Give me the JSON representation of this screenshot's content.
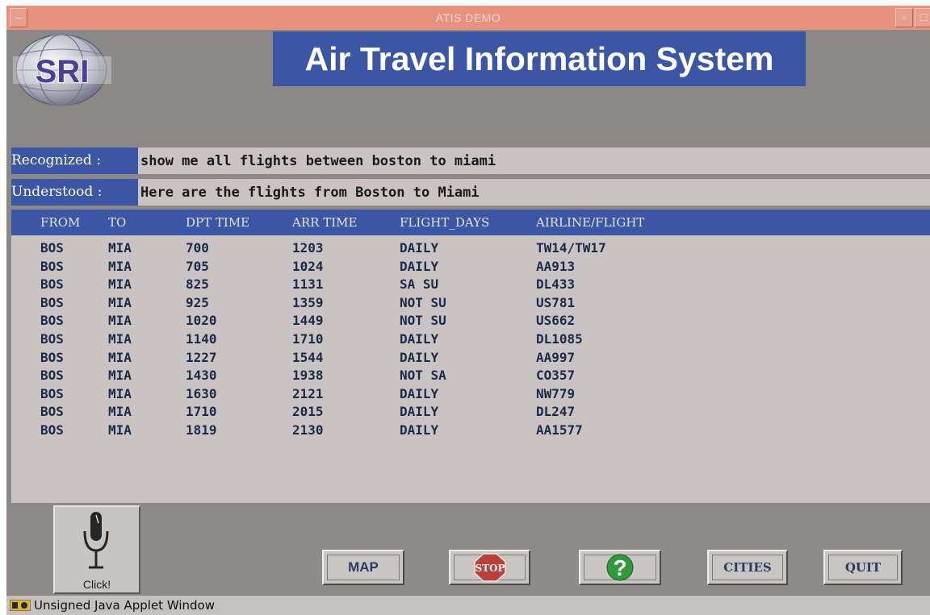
{
  "window": {
    "title": "ATIS DEMO",
    "minimize_glyph": "–",
    "maximize_glyph": "▫",
    "close_glyph": "□"
  },
  "logo": {
    "text": "SRI",
    "icon": "sri-globe-logo"
  },
  "banner": {
    "title": "Air Travel Information System"
  },
  "recognized": {
    "label": "Recognized : ",
    "text": "show me all flights between boston to miami"
  },
  "understood": {
    "label": "Understood : ",
    "text": "Here are the flights from Boston to Miami"
  },
  "table": {
    "columns": [
      "FROM",
      "TO",
      "DPT TIME",
      "ARR TIME",
      "FLIGHT_DAYS",
      "AIRLINE/FLIGHT"
    ],
    "rows": [
      [
        "BOS",
        "MIA",
        "700",
        "1203",
        "DAILY",
        "TW14/TW17"
      ],
      [
        "BOS",
        "MIA",
        "705",
        "1024",
        "DAILY",
        "AA913"
      ],
      [
        "BOS",
        "MIA",
        "825",
        "1131",
        "SA SU",
        "DL433"
      ],
      [
        "BOS",
        "MIA",
        "925",
        "1359",
        "NOT SU",
        "US781"
      ],
      [
        "BOS",
        "MIA",
        "1020",
        "1449",
        "NOT SU",
        "US662"
      ],
      [
        "BOS",
        "MIA",
        "1140",
        "1710",
        "DAILY",
        "DL1085"
      ],
      [
        "BOS",
        "MIA",
        "1227",
        "1544",
        "DAILY",
        "AA997"
      ],
      [
        "BOS",
        "MIA",
        "1430",
        "1938",
        "NOT SA",
        "CO357"
      ],
      [
        "BOS",
        "MIA",
        "1630",
        "2121",
        "DAILY",
        "NW779"
      ],
      [
        "BOS",
        "MIA",
        "1710",
        "2015",
        "DAILY",
        "DL247"
      ],
      [
        "BOS",
        "MIA",
        "1819",
        "2130",
        "DAILY",
        "AA1577"
      ]
    ]
  },
  "controls": {
    "mic_label": "Click!",
    "mic_icon": "microphone-icon",
    "map_label": "MAP",
    "stop_label": "STOP",
    "help_label": "?",
    "cities_label": "CITIES",
    "quit_label": "QUIT"
  },
  "status": {
    "text": "Unsigned Java Applet Window",
    "icon": "java-applet-icon"
  },
  "colors": {
    "window_bg": "#8b8987",
    "titlebar": "#e8917f",
    "accent_blue": "#3b56a4",
    "panel_light": "#c9c4c3",
    "stop_red": "#b9413c",
    "help_green": "#2f9a3a"
  }
}
